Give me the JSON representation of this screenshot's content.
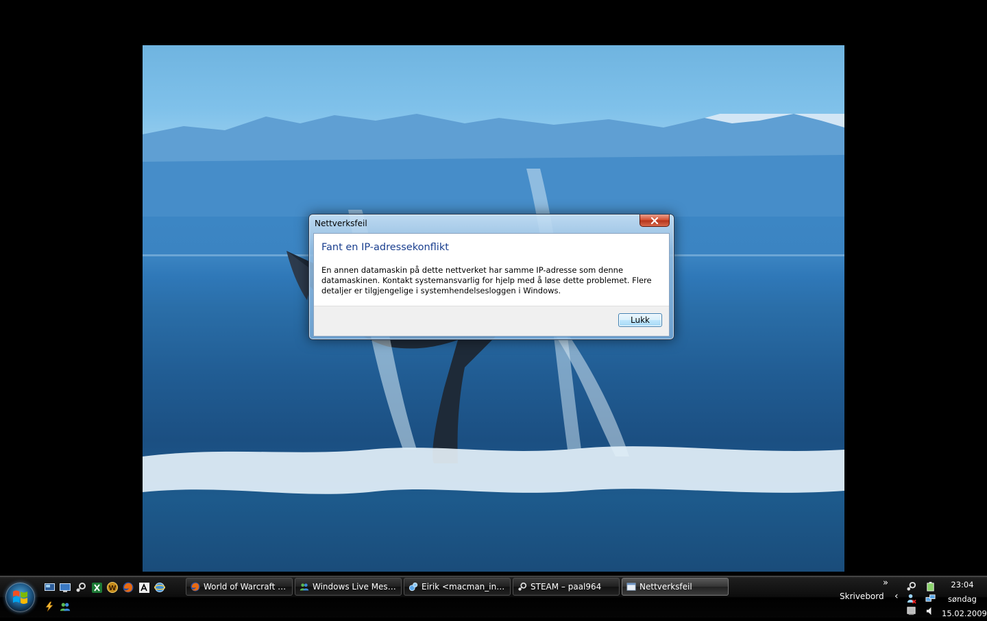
{
  "dialog": {
    "title": "Nettverksfeil",
    "heading": "Fant en IP-adressekonflikt",
    "message": "En annen datamaskin på dette nettverket har samme IP-adresse som denne datamaskinen. Kontakt systemansvarlig for hjelp med å løse dette problemet. Flere detaljer er tilgjengelige i systemhendelsesloggen i Windows.",
    "close_button": "Lukk"
  },
  "taskbar": {
    "start_icon": "windows-orb-icon",
    "quick_launch_row1": [
      "show-desktop-icon",
      "switch-windows-icon",
      "steam-icon",
      "excel-icon",
      "world-of-warcraft-icon",
      "firefox-icon",
      "cmd-icon",
      "browser-icon"
    ],
    "quick_launch_row2": [
      "lightning-icon",
      "messenger-icon"
    ],
    "tasks": [
      {
        "label": "World of Warcraft :: ...",
        "icon": "firefox-icon",
        "active": false
      },
      {
        "label": "Windows Live Mess...",
        "icon": "messenger-icon",
        "active": false
      },
      {
        "label": "Eirik <macman_infi...",
        "icon": "chat-icon",
        "active": false
      },
      {
        "label": "STEAM – paal964",
        "icon": "steam-icon",
        "active": false
      },
      {
        "label": "Nettverksfeil",
        "icon": "window-icon",
        "active": true
      }
    ],
    "overflow": "»",
    "desktop_toolbar": "Skrivebord",
    "tray_expand": "‹",
    "clock": {
      "time": "23:04",
      "day": "søndag",
      "date": "15.02.2009"
    }
  },
  "colors": {
    "heading_blue": "#1a3f8f",
    "close_red": "#d24a2a",
    "taskbar_black": "#0c0c0c"
  }
}
